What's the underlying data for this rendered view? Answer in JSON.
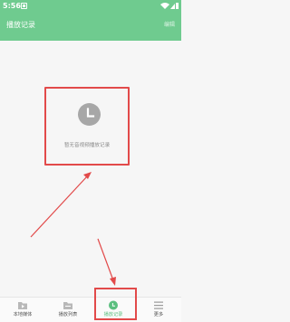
{
  "status_bar": {
    "time": "5:56"
  },
  "app_bar": {
    "title": "播放记录",
    "edit_label": "编辑"
  },
  "empty_state": {
    "icon": "clock-icon",
    "message": "暂无音视频播放记录"
  },
  "bottom_nav": {
    "items": [
      {
        "label": "本地媒体",
        "icon": "play-folder-icon",
        "active": false
      },
      {
        "label": "播放列表",
        "icon": "folder-icon",
        "active": false
      },
      {
        "label": "播放记录",
        "icon": "clock-icon",
        "active": true
      },
      {
        "label": "更多",
        "icon": "menu-icon",
        "active": false
      }
    ]
  },
  "colors": {
    "primary": "#6fcb8f",
    "annotation": "#e24a4a",
    "background": "#f6f6f6"
  }
}
